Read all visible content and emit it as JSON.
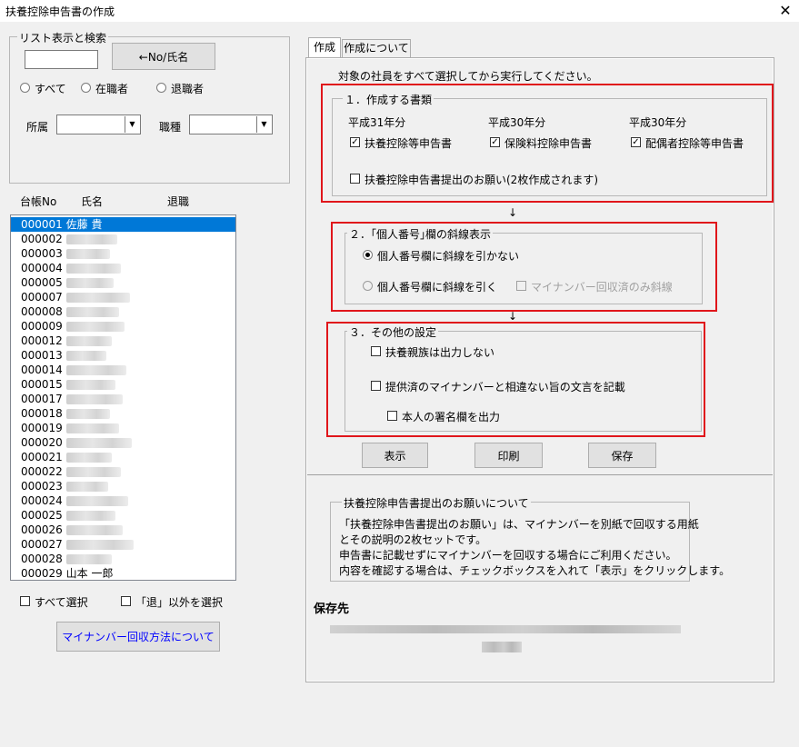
{
  "window": {
    "title": "扶養控除申告書の作成",
    "close_glyph": "✕"
  },
  "search": {
    "legend": "リスト表示と検索",
    "input_value": "",
    "no_name_button": "←No/氏名",
    "radios": [
      {
        "label": "すべて",
        "selected": false
      },
      {
        "label": "在職者",
        "selected": false
      },
      {
        "label": "退職者",
        "selected": false
      }
    ],
    "dept_label": "所属",
    "dept_value": "",
    "jobtype_label": "職種",
    "jobtype_value": ""
  },
  "list": {
    "headers": [
      "台帳No",
      "氏名",
      "退職"
    ],
    "rows": [
      {
        "no": "000001",
        "name": "佐藤 貴",
        "selected": true
      },
      {
        "no": "000002",
        "name": "",
        "selected": false
      },
      {
        "no": "000003",
        "name": "",
        "selected": false
      },
      {
        "no": "000004",
        "name": "",
        "selected": false
      },
      {
        "no": "000005",
        "name": "",
        "selected": false
      },
      {
        "no": "000007",
        "name": "",
        "selected": false
      },
      {
        "no": "000008",
        "name": "",
        "selected": false
      },
      {
        "no": "000009",
        "name": "",
        "selected": false
      },
      {
        "no": "000012",
        "name": "",
        "selected": false
      },
      {
        "no": "000013",
        "name": "",
        "selected": false
      },
      {
        "no": "000014",
        "name": "",
        "selected": false
      },
      {
        "no": "000015",
        "name": "",
        "selected": false
      },
      {
        "no": "000017",
        "name": "",
        "selected": false
      },
      {
        "no": "000018",
        "name": "",
        "selected": false
      },
      {
        "no": "000019",
        "name": "",
        "selected": false
      },
      {
        "no": "000020",
        "name": "",
        "selected": false
      },
      {
        "no": "000021",
        "name": "",
        "selected": false
      },
      {
        "no": "000022",
        "name": "",
        "selected": false
      },
      {
        "no": "000023",
        "name": "",
        "selected": false
      },
      {
        "no": "000024",
        "name": "",
        "selected": false
      },
      {
        "no": "000025",
        "name": "",
        "selected": false
      },
      {
        "no": "000026",
        "name": "",
        "selected": false
      },
      {
        "no": "000027",
        "name": "",
        "selected": false
      },
      {
        "no": "000028",
        "name": "",
        "selected": false
      },
      {
        "no": "000029",
        "name": "山本 一郎",
        "selected": false
      }
    ],
    "select_all": "すべて選択",
    "select_non_retired": "「退」以外を選択",
    "mynumber_button": "マイナンバー回収方法について"
  },
  "tabs": [
    {
      "label": "作成",
      "active": true
    },
    {
      "label": "作成について",
      "active": false
    }
  ],
  "main": {
    "instruction": "対象の社員をすべて選択してから実行してください。",
    "section1": {
      "legend": "１．作成する書類",
      "columns": [
        {
          "year": "平成31年分",
          "item": "扶養控除等申告書",
          "checked": true
        },
        {
          "year": "平成30年分",
          "item": "保険料控除申告書",
          "checked": true
        },
        {
          "year": "平成30年分",
          "item": "配偶者控除等申告書",
          "checked": true
        }
      ],
      "request_item": "扶養控除申告書提出のお願い(2枚作成されます)",
      "request_checked": false
    },
    "arrow": "↓",
    "section2": {
      "legend": "２．｢個人番号｣欄の斜線表示",
      "opt1": "個人番号欄に斜線を引かない",
      "opt2": "個人番号欄に斜線を引く",
      "opt3": "マイナンバー回収済のみ斜線"
    },
    "section3": {
      "legend": "３．その他の設定",
      "item1": "扶養親族は出力しない",
      "item2": "提供済のマイナンバーと相違ない旨の文言を記載",
      "item3": "本人の署名欄を出力"
    },
    "buttons": {
      "show": "表示",
      "print": "印刷",
      "save": "保存"
    },
    "info": {
      "legend": "扶養控除申告書提出のお願いについて",
      "lines": [
        "「扶養控除申告書提出のお願い」は、マイナンバーを別紙で回収する用紙",
        "とその説明の2枚セットです。",
        "申告書に記載せずにマイナンバーを回収する場合にご利用ください。",
        "内容を確認する場合は、チェックボックスを入れて「表示」をクリックします。"
      ]
    },
    "save_dest_label": "保存先",
    "colors": {
      "highlight_border": "#e0161b",
      "selection": "#0078d7",
      "link_button_text": "#0000ff"
    }
  }
}
